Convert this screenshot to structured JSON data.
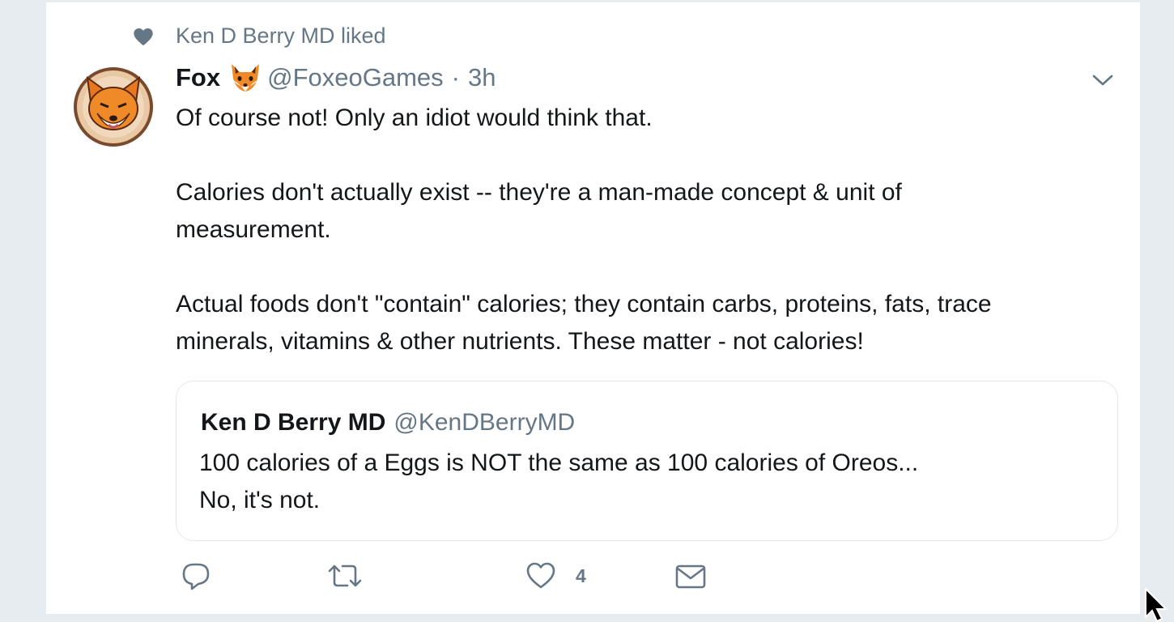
{
  "context": {
    "icon": "heart-icon",
    "text": "Ken D Berry MD liked"
  },
  "tweet": {
    "author_name": "Fox",
    "author_emoji": "fox-emoji",
    "handle": "@FoxeoGames",
    "separator": "·",
    "time": "3h",
    "paragraphs": [
      [
        "Of course not! Only an idiot would think that."
      ],
      [
        "Calories don't actually exist -- they're a man-made concept & unit of",
        "measurement."
      ],
      [
        "Actual foods don't \"contain\" calories; they contain carbs, proteins, fats, trace",
        "minerals, vitamins & other nutrients. These matter - not calories!"
      ]
    ]
  },
  "quote": {
    "author_name": "Ken D Berry MD",
    "handle": "@KenDBerryMD",
    "lines": [
      "100 calories of a Eggs is NOT the same as 100 calories of Oreos...",
      "No, it's not."
    ]
  },
  "actions": {
    "reply_icon": "reply-icon",
    "retweet_icon": "retweet-icon",
    "like_icon": "like-icon",
    "like_count": "4",
    "dm_icon": "envelope-icon"
  },
  "colors": {
    "muted": "#657786",
    "text": "#14171a",
    "border": "#e1e8ed",
    "background": "#e6ecf0"
  }
}
